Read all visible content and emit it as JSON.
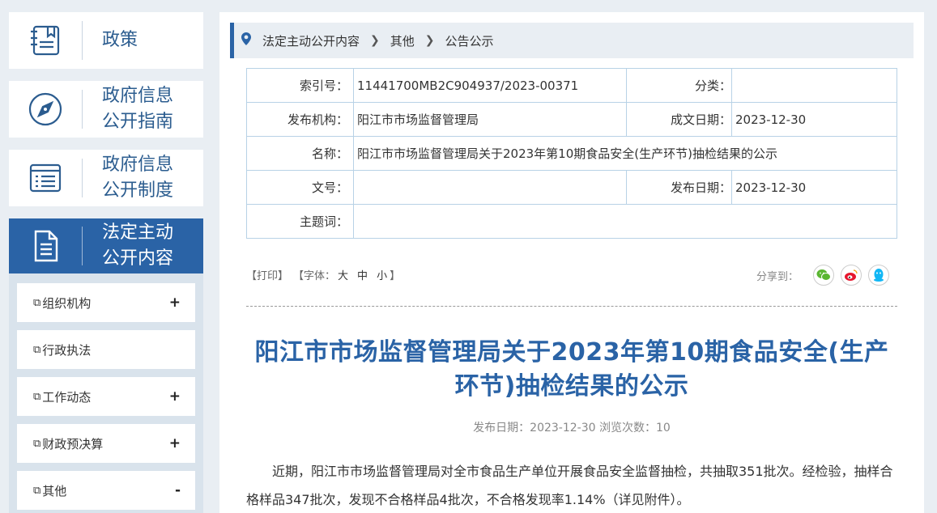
{
  "sidebar": {
    "nav": [
      {
        "label": "政策",
        "icon": "book-icon"
      },
      {
        "label": "政府信息\n公开指南",
        "icon": "compass-icon"
      },
      {
        "label": "政府信息\n公开制度",
        "icon": "list-icon"
      },
      {
        "label": "法定主动\n公开内容",
        "icon": "document-icon",
        "active": true
      }
    ],
    "subitems": [
      {
        "label": "组织机构",
        "toggle": "+"
      },
      {
        "label": "行政执法",
        "toggle": ""
      },
      {
        "label": "工作动态",
        "toggle": "+"
      },
      {
        "label": "财政预决算",
        "toggle": "+"
      },
      {
        "label": "其他",
        "toggle": "-"
      }
    ]
  },
  "breadcrumb": [
    "法定主动公开内容",
    "其他",
    "公告公示"
  ],
  "meta": {
    "index_label": "索引号：",
    "index_value": "11441700MB2C904937/2023-00371",
    "category_label": "分类：",
    "category_value": "",
    "publisher_label": "发布机构：",
    "publisher_value": "阳江市市场监督管理局",
    "created_label": "成文日期：",
    "created_value": "2023-12-30",
    "name_label": "名称：",
    "name_value": "阳江市市场监督管理局关于2023年第10期食品安全(生产环节)抽检结果的公示",
    "docno_label": "文号：",
    "docno_value": "",
    "pubdate_label": "发布日期：",
    "pubdate_value": "2023-12-30",
    "subject_label": "主题词：",
    "subject_value": ""
  },
  "tools": {
    "print": "【打印】",
    "font_prefix": "【字体：",
    "font_large": "大",
    "font_medium": "中",
    "font_small": "小",
    "font_suffix": "】",
    "share_label": "分享到："
  },
  "article": {
    "title": "阳江市市场监督管理局关于2023年第10期食品安全(生产环节)抽检结果的公示",
    "pubinfo": "发布日期：2023-12-30  浏览次数：10",
    "body": "近期，阳江市市场监督管理局对全市食品生产单位开展食品安全监督抽检，共抽取351批次。经检验，抽样合格样品347批次，发现不合格样品4批次，不合格发现率1.14%（详见附件）。"
  },
  "colors": {
    "accent": "#2a63a6",
    "title": "#2a63a6",
    "table_border": "#b8d2e6",
    "background": "#e9eef3"
  }
}
